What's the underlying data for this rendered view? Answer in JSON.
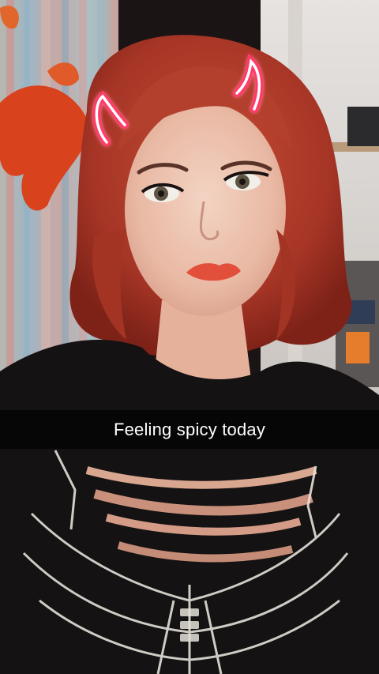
{
  "snap": {
    "caption": "Feeling spicy today",
    "filter": "devil-horns-neon",
    "colors": {
      "horn_neon": "#ff3b6b",
      "horn_core": "#ffffff",
      "hair": "#b8402c",
      "shirt": "#121111",
      "caption_bar": "#000000"
    }
  }
}
